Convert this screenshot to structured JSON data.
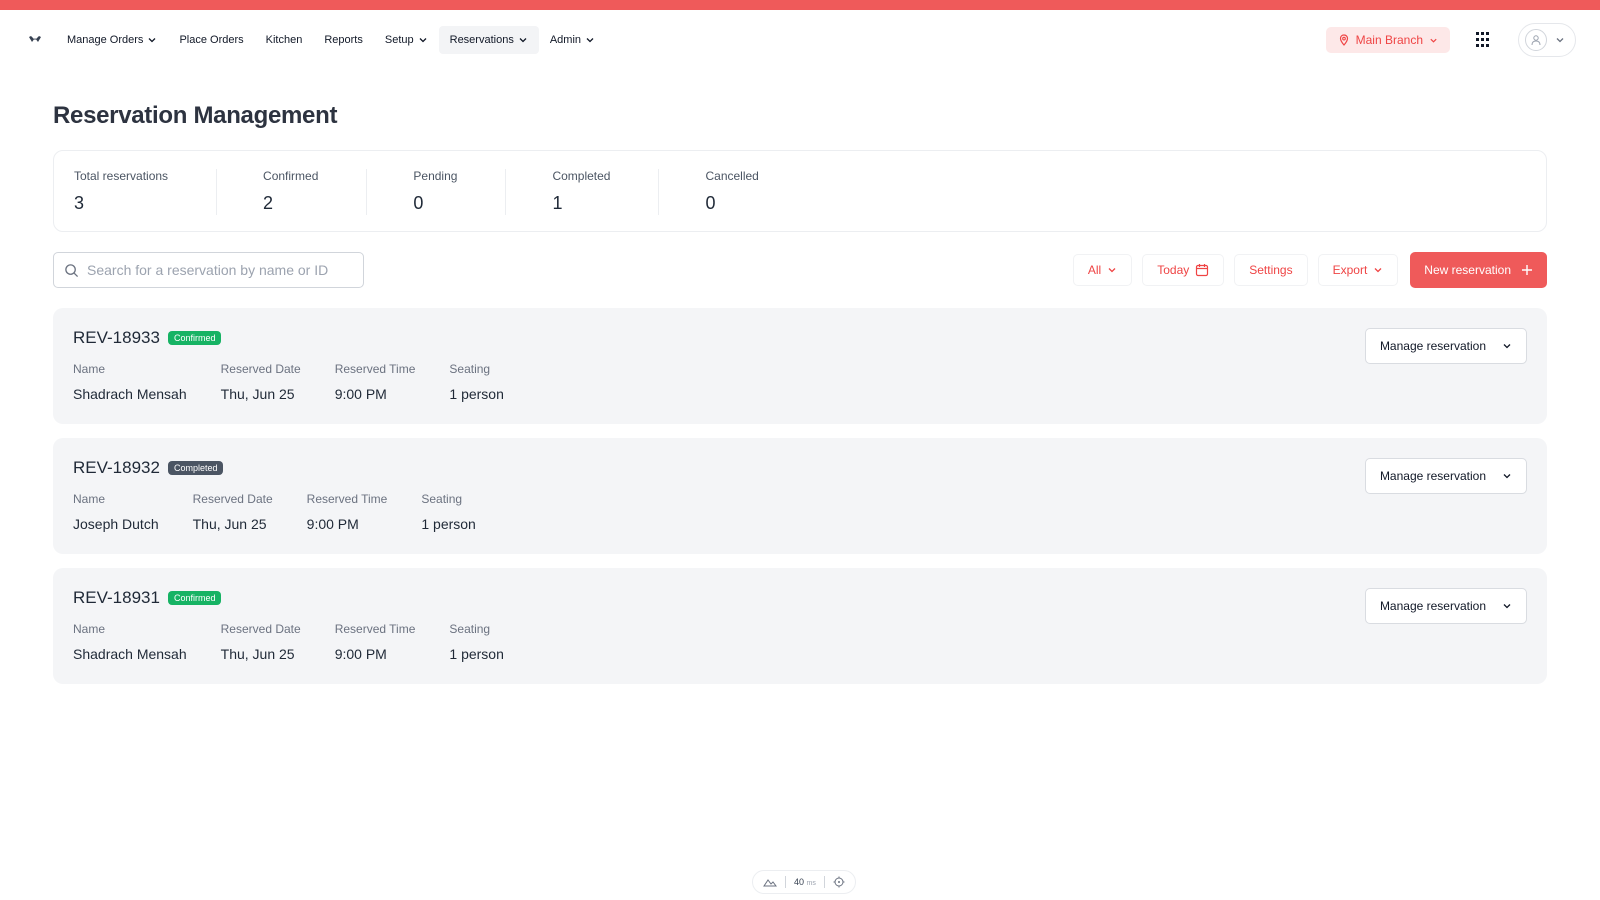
{
  "nav": {
    "items": [
      {
        "label": "Manage Orders",
        "dropdown": true,
        "active": false
      },
      {
        "label": "Place Orders",
        "dropdown": false,
        "active": false
      },
      {
        "label": "Kitchen",
        "dropdown": false,
        "active": false
      },
      {
        "label": "Reports",
        "dropdown": false,
        "active": false
      },
      {
        "label": "Setup",
        "dropdown": true,
        "active": false
      },
      {
        "label": "Reservations",
        "dropdown": true,
        "active": true
      },
      {
        "label": "Admin",
        "dropdown": true,
        "active": false
      }
    ],
    "branch_label": "Main Branch"
  },
  "page": {
    "title": "Reservation Management"
  },
  "stats": [
    {
      "label": "Total reservations",
      "value": "3"
    },
    {
      "label": "Confirmed",
      "value": "2"
    },
    {
      "label": "Pending",
      "value": "0"
    },
    {
      "label": "Completed",
      "value": "1"
    },
    {
      "label": "Cancelled",
      "value": "0"
    }
  ],
  "toolbar": {
    "search_placeholder": "Search for a reservation by name or ID",
    "filter_label": "All",
    "date_label": "Today",
    "settings_label": "Settings",
    "export_label": "Export",
    "new_label": "New reservation"
  },
  "field_labels": {
    "name": "Name",
    "date": "Reserved Date",
    "time": "Reserved Time",
    "seating": "Seating"
  },
  "reservations": [
    {
      "id": "REV-18933",
      "status": "Confirmed",
      "status_key": "confirmed",
      "name": "Shadrach Mensah",
      "date": "Thu, Jun 25",
      "time": "9:00 PM",
      "seating": "1 person",
      "action": "Manage reservation"
    },
    {
      "id": "REV-18932",
      "status": "Completed",
      "status_key": "completed",
      "name": "Joseph Dutch",
      "date": "Thu, Jun 25",
      "time": "9:00 PM",
      "seating": "1 person",
      "action": "Manage reservation"
    },
    {
      "id": "REV-18931",
      "status": "Confirmed",
      "status_key": "confirmed",
      "name": "Shadrach Mensah",
      "date": "Thu, Jun 25",
      "time": "9:00 PM",
      "seating": "1 person",
      "action": "Manage reservation"
    }
  ],
  "perf": {
    "value": "40",
    "unit": "ms"
  },
  "colors": {
    "accent": "#ef5a5a",
    "confirmed": "#16b364",
    "completed": "#4b5563"
  }
}
